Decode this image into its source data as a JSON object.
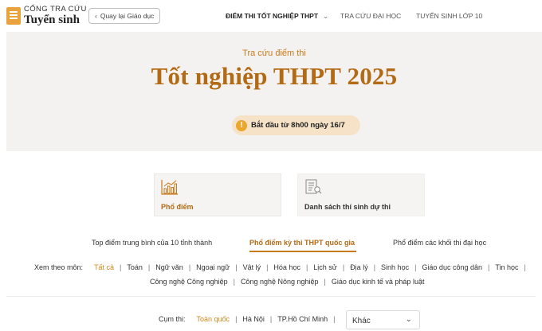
{
  "header": {
    "logo_line1": "CỔNG TRA CỨU",
    "logo_line2": "Tuyển sinh",
    "back_label": "Quay lại Giáo dục",
    "nav": [
      {
        "label": "ĐIỂM THI TỐT NGHIỆP THPT",
        "active": true,
        "dropdown": true
      },
      {
        "label": "TRA CỨU ĐẠI HỌC"
      },
      {
        "label": "TUYỂN SINH LỚP 10"
      }
    ]
  },
  "hero": {
    "subtitle": "Tra cứu điểm thi",
    "title": "Tốt nghiệp THPT 2025",
    "notice": "Bắt đầu từ 8h00 ngày 16/7"
  },
  "cards": [
    {
      "label": "Phổ điểm",
      "icon": "bar-chart-icon"
    },
    {
      "label": "Danh sách thí sinh dự thi",
      "icon": "document-list-icon"
    }
  ],
  "tabs": [
    {
      "label": "Top điểm trung bình của 10 tỉnh thành"
    },
    {
      "label": "Phổ điểm kỳ thi THPT quốc gia",
      "active": true
    },
    {
      "label": "Phổ điểm các khối thi đại học"
    }
  ],
  "subjects": {
    "label": "Xem theo môn:",
    "row1": [
      "Tất cả",
      "Toán",
      "Ngữ văn",
      "Ngoại ngữ",
      "Vật lý",
      "Hóa học",
      "Lịch sử",
      "Địa lý",
      "Sinh học",
      "Giáo dục công dân",
      "Tin học"
    ],
    "row2": [
      "Công nghệ Công nghiệp",
      "Công nghệ Nông nghiệp",
      "Giáo dục kinh tế và pháp luật"
    ],
    "active": "Tất cả"
  },
  "cluster": {
    "label": "Cụm thi:",
    "options": [
      "Toàn quốc",
      "Hà Nội",
      "TP.Hồ Chí Minh"
    ],
    "active": "Toàn quốc",
    "select_value": "Khác"
  },
  "colors": {
    "accent": "#b26a14",
    "accent_light": "#d4891e",
    "hero_bg": "#f4f2f0",
    "pill_bg": "#f5e2c7"
  }
}
